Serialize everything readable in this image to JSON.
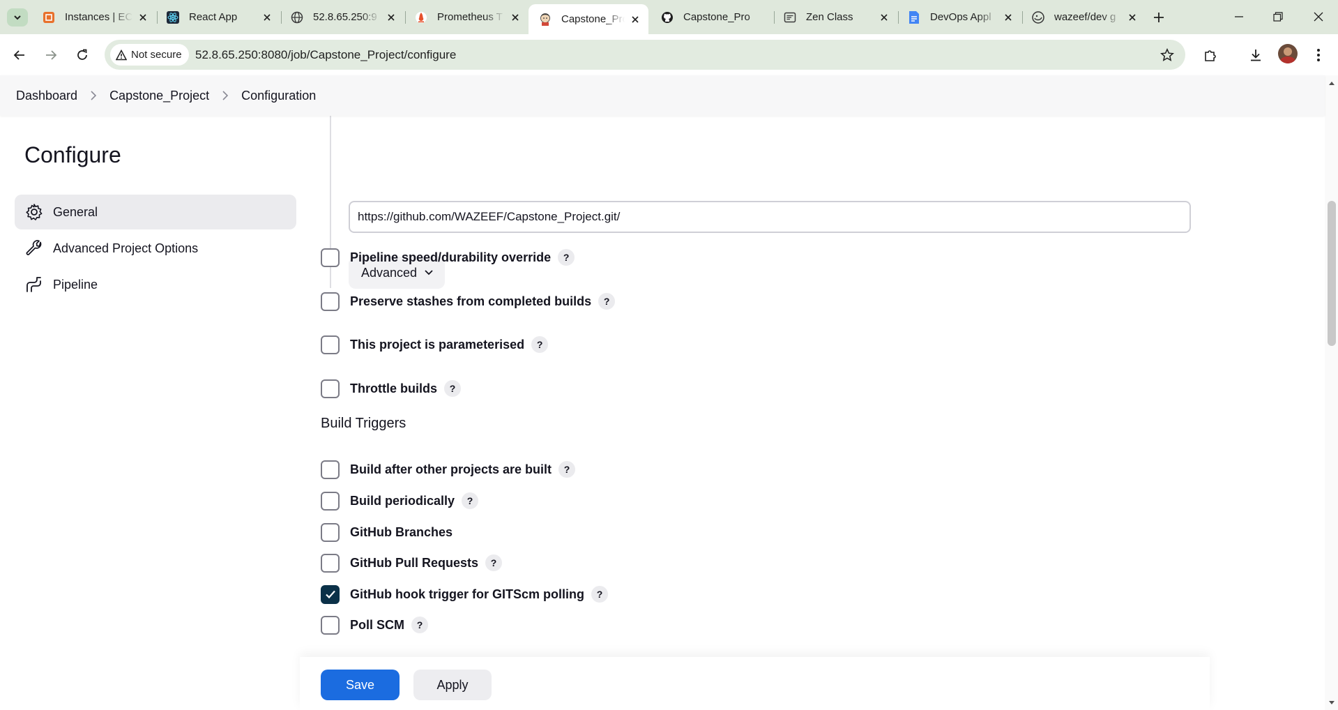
{
  "browser": {
    "tabs": [
      {
        "title": "Instances | EC",
        "icon": "aws-icon",
        "color": "#e8712c"
      },
      {
        "title": "React App",
        "icon": "react-icon",
        "color": "#1e2a3a"
      },
      {
        "title": "52.8.65.250:9",
        "icon": "globe-icon",
        "color": "#5f6368"
      },
      {
        "title": "Prometheus T",
        "icon": "prometheus-icon",
        "color": "#e6522c"
      },
      {
        "title": "Capstone_Pro",
        "icon": "jenkins-icon",
        "color": "#d24939"
      },
      {
        "title": "Capstone_Pro",
        "icon": "github-icon",
        "color": "#1f1f1f"
      },
      {
        "title": "Zen Class",
        "icon": "zen-icon",
        "color": "#444444"
      },
      {
        "title": "DevOps Appl",
        "icon": "docs-icon",
        "color": "#4285f4"
      },
      {
        "title": "wazeef/dev g",
        "icon": "docker-icon",
        "color": "#333333"
      }
    ],
    "active_tab_index": 4,
    "security_label": "Not secure",
    "url": "52.8.65.250:8080/job/Capstone_Project/configure"
  },
  "breadcrumb": {
    "items": [
      "Dashboard",
      "Capstone_Project",
      "Configuration"
    ]
  },
  "sidebar": {
    "title": "Configure",
    "items": [
      {
        "label": "General",
        "icon": "gear-icon",
        "selected": true
      },
      {
        "label": "Advanced Project Options",
        "icon": "wrench-icon",
        "selected": false
      },
      {
        "label": "Pipeline",
        "icon": "pipeline-icon",
        "selected": false
      }
    ]
  },
  "main": {
    "repository_url": "https://github.com/WAZEEF/Capstone_Project.git/",
    "advanced_label": "Advanced",
    "general_options": [
      {
        "label": "Pipeline speed/durability override",
        "checked": false,
        "help": "?"
      },
      {
        "label": "Preserve stashes from completed builds",
        "checked": false,
        "help": "?"
      },
      {
        "label": "This project is parameterised",
        "checked": false,
        "help": "?"
      },
      {
        "label": "Throttle builds",
        "checked": false,
        "help": "?"
      }
    ],
    "build_triggers_title": "Build Triggers",
    "build_triggers": [
      {
        "label": "Build after other projects are built",
        "checked": false,
        "help": "?"
      },
      {
        "label": "Build periodically",
        "checked": false,
        "help": "?"
      },
      {
        "label": "GitHub Branches",
        "checked": false,
        "help": ""
      },
      {
        "label": "GitHub Pull Requests",
        "checked": false,
        "help": "?"
      },
      {
        "label": "GitHub hook trigger for GITScm polling",
        "checked": true,
        "help": "?"
      },
      {
        "label": "Poll SCM",
        "checked": false,
        "help": "?"
      }
    ]
  },
  "footer": {
    "save_label": "Save",
    "apply_label": "Apply"
  },
  "colors": {
    "accent": "#1b6ce0",
    "checkbox_checked": "#0b3148",
    "tabstrip": "#dfe8dc"
  }
}
